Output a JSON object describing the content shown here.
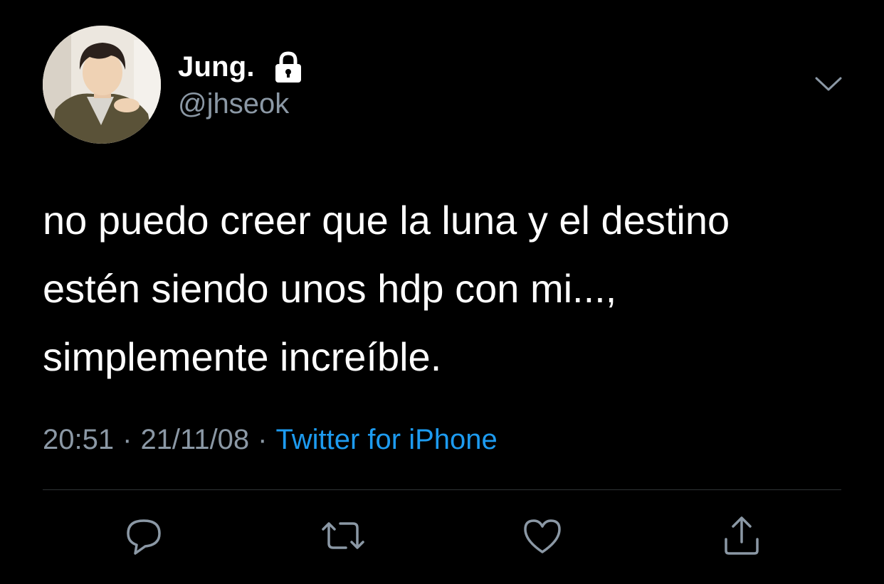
{
  "tweet": {
    "author": {
      "display_name": "Jung.",
      "handle": "@jhseok",
      "protected": true,
      "avatar_icon": "profile-photo"
    },
    "text_lines": [
      "no puedo creer que la luna y el destino",
      "estén siendo unos hdp con mi...,",
      "simplemente increíble."
    ],
    "meta": {
      "time": "20:51",
      "separator": "·",
      "date": "21/11/08",
      "source": "Twitter for iPhone"
    },
    "actions": [
      {
        "icon": "reply-icon"
      },
      {
        "icon": "retweet-icon"
      },
      {
        "icon": "like-icon"
      },
      {
        "icon": "share-icon"
      }
    ],
    "menu_icon": "chevron-down-icon"
  },
  "colors": {
    "background": "#000000",
    "text_primary": "#ffffff",
    "text_secondary": "#8b98a5",
    "link": "#1d9bf0",
    "divider": "#2f3336"
  }
}
